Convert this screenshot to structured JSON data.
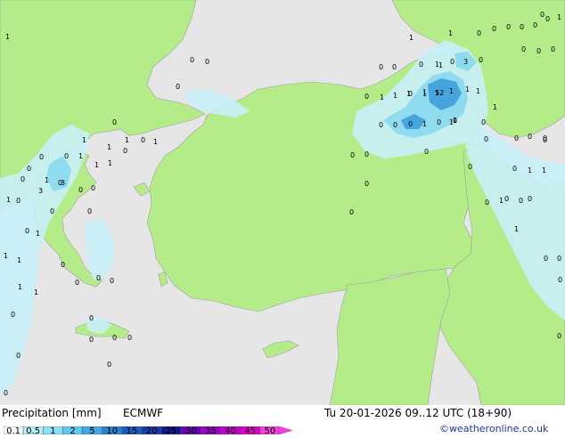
{
  "map": {
    "colors": {
      "sea": "#e6e6e6",
      "land": "#b5ec8a",
      "precip_light": "#c8f0f8",
      "precip_mid": "#88d8f0",
      "precip_heavy": "#3a9ad8",
      "coast": "#a0a0a0",
      "border": "#c0c0c0"
    },
    "precip_values": [
      {
        "id": "v1",
        "text": "1"
      },
      {
        "id": "v2",
        "text": "0"
      },
      {
        "id": "v3",
        "text": "0"
      },
      {
        "id": "v4",
        "text": "0"
      },
      {
        "id": "v5",
        "text": "0"
      },
      {
        "id": "v6",
        "text": "0"
      },
      {
        "id": "v7",
        "text": "0"
      },
      {
        "id": "v8",
        "text": "1"
      },
      {
        "id": "v9",
        "text": "1"
      },
      {
        "id": "v10",
        "text": "0"
      },
      {
        "id": "v11",
        "text": "3"
      },
      {
        "id": "v12",
        "text": "0"
      },
      {
        "id": "v13",
        "text": "0"
      },
      {
        "id": "v14",
        "text": "0"
      },
      {
        "id": "v15",
        "text": "1"
      },
      {
        "id": "v16",
        "text": "0"
      },
      {
        "id": "v17",
        "text": "1"
      },
      {
        "id": "v18",
        "text": "1"
      },
      {
        "id": "v19",
        "text": "0"
      },
      {
        "id": "v20",
        "text": "0"
      },
      {
        "id": "v21",
        "text": "1"
      },
      {
        "id": "v22",
        "text": "0"
      },
      {
        "id": "v23",
        "text": "0"
      },
      {
        "id": "v24",
        "text": "0"
      },
      {
        "id": "v25",
        "text": "1"
      },
      {
        "id": "v26",
        "text": "3"
      },
      {
        "id": "v27",
        "text": "0"
      },
      {
        "id": "v28",
        "text": "0"
      },
      {
        "id": "v29",
        "text": "0"
      },
      {
        "id": "v30",
        "text": "0"
      },
      {
        "id": "v31",
        "text": "0"
      },
      {
        "id": "v32",
        "text": "1"
      },
      {
        "id": "v33",
        "text": "0"
      },
      {
        "id": "v34",
        "text": "1"
      },
      {
        "id": "v35",
        "text": "1"
      },
      {
        "id": "v36",
        "text": "0"
      },
      {
        "id": "v37",
        "text": "0"
      },
      {
        "id": "v38",
        "text": "0"
      },
      {
        "id": "v39",
        "text": "0"
      },
      {
        "id": "v40",
        "text": "0"
      },
      {
        "id": "v41",
        "text": "0"
      },
      {
        "id": "v42",
        "text": "0"
      },
      {
        "id": "v43",
        "text": "0"
      },
      {
        "id": "v44",
        "text": "0"
      },
      {
        "id": "v45",
        "text": "0"
      },
      {
        "id": "v46",
        "text": "0"
      },
      {
        "id": "v47",
        "text": "0"
      },
      {
        "id": "v48",
        "text": "1"
      },
      {
        "id": "v49",
        "text": "0"
      },
      {
        "id": "v50",
        "text": "0"
      },
      {
        "id": "v51",
        "text": "1"
      },
      {
        "id": "v52",
        "text": "1"
      },
      {
        "id": "v53",
        "text": "0"
      },
      {
        "id": "v54",
        "text": "1"
      },
      {
        "id": "v55",
        "text": "0"
      },
      {
        "id": "v56",
        "text": "0"
      },
      {
        "id": "v57",
        "text": "0"
      },
      {
        "id": "v58",
        "text": "0"
      },
      {
        "id": "v59",
        "text": "0"
      },
      {
        "id": "v60",
        "text": "0"
      },
      {
        "id": "v61",
        "text": "1"
      },
      {
        "id": "v62",
        "text": "0"
      },
      {
        "id": "v63",
        "text": "1"
      },
      {
        "id": "v64",
        "text": "3"
      },
      {
        "id": "v65",
        "text": "0"
      },
      {
        "id": "v66",
        "text": "0"
      },
      {
        "id": "v67",
        "text": "0"
      },
      {
        "id": "v68",
        "text": "0"
      },
      {
        "id": "v69",
        "text": "1"
      },
      {
        "id": "v70",
        "text": "1"
      },
      {
        "id": "v71",
        "text": "1"
      },
      {
        "id": "v72",
        "text": "1"
      },
      {
        "id": "v73",
        "text": "0"
      },
      {
        "id": "v74",
        "text": "1"
      },
      {
        "id": "v75",
        "text": "1"
      },
      {
        "id": "v76",
        "text": "1"
      },
      {
        "id": "v77",
        "text": "0"
      },
      {
        "id": "v78",
        "text": "0"
      },
      {
        "id": "v79",
        "text": "1"
      },
      {
        "id": "v80",
        "text": "1"
      },
      {
        "id": "v81",
        "text": "0"
      },
      {
        "id": "v82",
        "text": "1"
      },
      {
        "id": "v83",
        "text": "1"
      },
      {
        "id": "v84",
        "text": "1"
      },
      {
        "id": "v85",
        "text": "5"
      },
      {
        "id": "v86",
        "text": "12"
      },
      {
        "id": "v87",
        "text": "1"
      },
      {
        "id": "v88",
        "text": "1"
      },
      {
        "id": "v89",
        "text": "1"
      },
      {
        "id": "v90",
        "text": "0"
      },
      {
        "id": "v91",
        "text": "0"
      },
      {
        "id": "v92",
        "text": "0"
      },
      {
        "id": "v93",
        "text": "0"
      },
      {
        "id": "v94",
        "text": "0"
      },
      {
        "id": "v95",
        "text": "0"
      },
      {
        "id": "v96",
        "text": "0"
      },
      {
        "id": "v97",
        "text": "0"
      },
      {
        "id": "v98",
        "text": "0"
      },
      {
        "id": "v99",
        "text": "0"
      },
      {
        "id": "v100",
        "text": "1"
      },
      {
        "id": "v101",
        "text": "0"
      },
      {
        "id": "v102",
        "text": "1"
      },
      {
        "id": "v103",
        "text": "0"
      },
      {
        "id": "v104",
        "text": "1"
      },
      {
        "id": "v105",
        "text": "0"
      },
      {
        "id": "v106",
        "text": "0"
      },
      {
        "id": "v107",
        "text": "0"
      },
      {
        "id": "v108",
        "text": "1"
      },
      {
        "id": "v109",
        "text": "0"
      },
      {
        "id": "v110",
        "text": "0"
      },
      {
        "id": "v111",
        "text": "0"
      },
      {
        "id": "v112",
        "text": "0"
      },
      {
        "id": "v113",
        "text": "0"
      }
    ]
  },
  "footer": {
    "title": "Precipitation [mm]",
    "model": "ECMWF",
    "datetime": "Tu 20-01-2026 09..12 UTC (18+90)",
    "credit": "©weatheronline.co.uk",
    "legend": {
      "ticks": [
        "0.1",
        "0.5",
        "1",
        "2",
        "5",
        "10",
        "15",
        "20",
        "25",
        "30",
        "35",
        "40",
        "45",
        "50"
      ],
      "colors": [
        "#ffffff",
        "#b8f0f8",
        "#88e0f4",
        "#60c8ee",
        "#40a8e4",
        "#2a82d4",
        "#1c5cc0",
        "#1a3aa8",
        "#16168c",
        "#6a00b4",
        "#9a00c8",
        "#c000cc",
        "#e000c8",
        "#f040d8"
      ]
    }
  }
}
